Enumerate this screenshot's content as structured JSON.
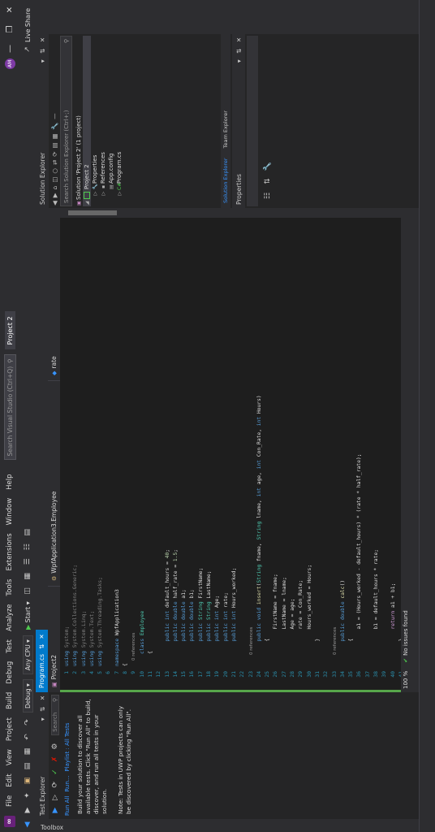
{
  "menu": {
    "items": [
      "File",
      "Edit",
      "View",
      "Project",
      "Build",
      "Debug",
      "Test",
      "Analyze",
      "Tools",
      "Extensions",
      "Window",
      "Help"
    ],
    "search_placeholder": "Search Visual Studio (Ctrl+Q)",
    "project_name": "Project 2",
    "live_share": "Live Share",
    "user_initials": "AM"
  },
  "toolbar": {
    "config": "Debug",
    "platform": "Any CPU",
    "start_label": "Start"
  },
  "toolbox": {
    "label": "Toolbox"
  },
  "test_explorer": {
    "title": "Test Explorer",
    "search_placeholder": "Search",
    "links": [
      "Run All",
      "Run...",
      "Playlist : All Tests"
    ],
    "description": "Build your solution to discover all available tests. Click \"Run All\" to build, discover, and run all tests in your solution.",
    "note": "Note: Tests in UWP projects can only be discovered by clicking \"Run All\"."
  },
  "editor": {
    "tab_label": "Program.cs",
    "project_tab": "Project2",
    "nav_namespace": "WpfApplication3.Employee",
    "nav_member": "rate",
    "line_numbers": [
      "1",
      "2",
      "3",
      "4",
      "5",
      "6",
      "7",
      "8",
      "9",
      "10",
      "11",
      "12",
      "13",
      "14",
      "15",
      "16",
      "17",
      "18",
      "19",
      "20",
      "21",
      "22",
      "23",
      "24",
      "25",
      "26",
      "27",
      "28",
      "29",
      "30",
      "31",
      "32",
      "33",
      "34",
      "35",
      "36",
      "37",
      "38",
      "39",
      "40",
      "41",
      "42"
    ],
    "code_lines": [
      "using System;",
      "using System.Collections.Generic;",
      "using System.Linq;",
      "using System.Text;",
      "using System.Threading.Tasks;",
      "",
      "namespace WpfApplication3",
      "{",
      "    0 references",
      "    class Employee",
      "    {",
      "",
      "        public int default_hours = 40;",
      "        public double half_rate = 1.5;",
      "        public double a1;",
      "        public double b1;",
      "        public String FirstName;",
      "        public String LastName;",
      "        public int Age;",
      "        public int rate;",
      "        public int Hours_worked;",
      "",
      "        0 references",
      "        public void insert(String fname, String lname, int age, int Con_Rate, int Hours)",
      "        {",
      "            FirstName = fname;",
      "            LastName = lname;",
      "            Age = age;",
      "            rate = Con_Rate;",
      "            Hours_worked = Hours;",
      "        }",
      "",
      "        0 references",
      "        public double calc()",
      "        {",
      "            a1 = (Hours_worked - default_hours) * (rate * half_rate);",
      "",
      "            b1 = default_hours * rate;",
      "",
      "            return a1 + b1;",
      "        }",
      "    }"
    ],
    "zoom": "100 %",
    "issues": "No issues found"
  },
  "solution_explorer": {
    "title": "Solution Explorer",
    "search_placeholder": "Search Solution Explorer (Ctrl+;)",
    "items": [
      "Solution 'Project 2' (1 project)",
      "Project 2",
      "Properties",
      "References",
      "App.config",
      "Program.cs"
    ],
    "tabs": [
      "Solution Explorer",
      "Team Explorer"
    ]
  },
  "properties": {
    "title": "Properties"
  },
  "colors": {
    "accent": "#007acc",
    "background": "#1e1e1e",
    "panel": "#252526",
    "chrome": "#2d2d30"
  }
}
